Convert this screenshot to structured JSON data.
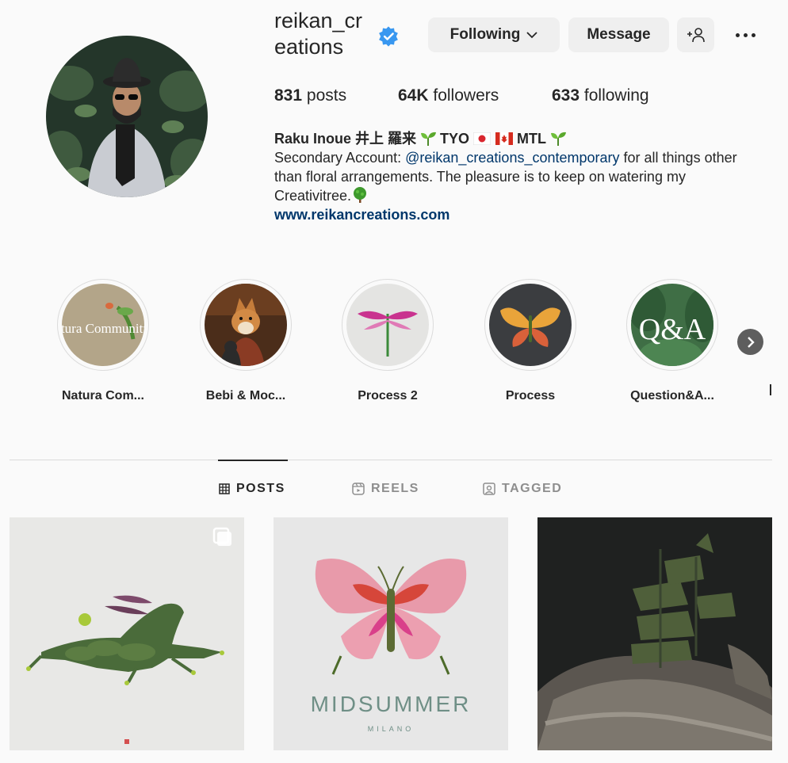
{
  "profile": {
    "username": "reikan_creations",
    "verified": true,
    "buttons": {
      "following": "Following",
      "message": "Message"
    },
    "stats": {
      "posts_count": "831",
      "posts_label": "posts",
      "followers_count": "64K",
      "followers_label": "followers",
      "following_count": "633",
      "following_label": "following"
    },
    "bio": {
      "name": "Raku Inoue 井上 羅来",
      "locations": [
        "TYO",
        "MTL"
      ],
      "line1_prefix": "Secondary Account: ",
      "mention": "@reikan_creations_contemporary",
      "line1_suffix": " for all things other than floral arrangements. The pleasure is to keep on watering my Creativitree.",
      "website": "www.reikancreations.com"
    }
  },
  "highlights": [
    {
      "label": "Natura Com...",
      "image_text": "Natura Community"
    },
    {
      "label": "Bebi & Moc..."
    },
    {
      "label": "Process 2"
    },
    {
      "label": "Process"
    },
    {
      "label": "Question&A...",
      "image_text": "Q&A"
    }
  ],
  "tabs": [
    {
      "label": "POSTS",
      "icon": "grid-icon",
      "active": true
    },
    {
      "label": "REELS",
      "icon": "reels-icon",
      "active": false
    },
    {
      "label": "TAGGED",
      "icon": "tagged-icon",
      "active": false
    }
  ],
  "posts": [
    {
      "subject": "leaf rabbit",
      "multi_image": true
    },
    {
      "title": "MIDSUMMER",
      "subtitle": "MILANO"
    },
    {
      "subject": "leaf ship"
    }
  ],
  "colors": {
    "verified": "#3897f0",
    "link": "#00376b",
    "divider": "#dbdbdb"
  }
}
